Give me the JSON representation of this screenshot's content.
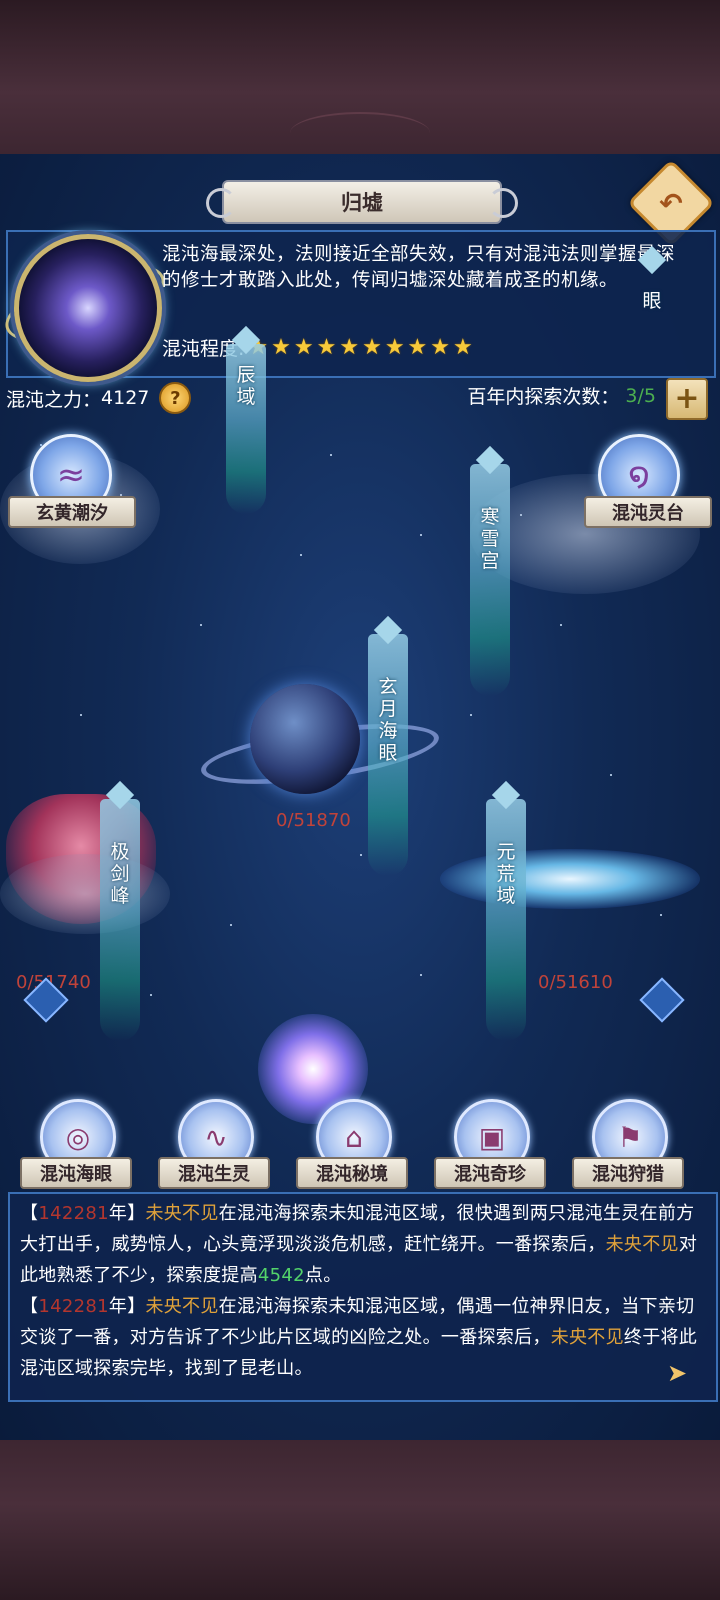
{
  "header": {
    "title": "归墟",
    "back_icon": "back-arrow-icon"
  },
  "info": {
    "description": "混沌海最深处，法则接近全部失效，只有对混沌法则掌握最深的修士才敢踏入此处，传闻归墟深处藏着成圣的机缘。",
    "chaos_level_label": "混沌程度:",
    "chaos_level_stars": 10
  },
  "status": {
    "power_label": "混沌之力：",
    "power_value": "4127",
    "help_icon": "?",
    "explore_label": "百年内探索次数：",
    "explore_count": "3/5",
    "add_icon": "+"
  },
  "map": {
    "locations": [
      {
        "name": "辰域",
        "chars": [
          "辰",
          "域"
        ]
      },
      {
        "name": "眼",
        "chars": [
          "眼"
        ]
      },
      {
        "name": "寒雪宫",
        "chars": [
          "寒",
          "雪",
          "宫"
        ]
      },
      {
        "name": "玄月海眼",
        "chars": [
          "玄",
          "月",
          "海",
          "眼"
        ]
      },
      {
        "name": "极剑峰",
        "chars": [
          "极",
          "剑",
          "峰"
        ]
      },
      {
        "name": "元荒域",
        "chars": [
          "元",
          "荒",
          "域"
        ]
      }
    ],
    "progress": {
      "xuanyue": "0/51870",
      "jijian": "0/51740",
      "yuanhuang": "0/51610"
    },
    "side_nodes": {
      "left": "玄黄潮汐",
      "right": "混沌灵台"
    }
  },
  "bottom_nav": [
    {
      "label": "混沌海眼",
      "icon": "whirlpool-icon"
    },
    {
      "label": "混沌生灵",
      "icon": "creature-icon"
    },
    {
      "label": "混沌秘境",
      "icon": "temple-icon"
    },
    {
      "label": "混沌奇珍",
      "icon": "treasure-chest-icon"
    },
    {
      "label": "混沌狩猎",
      "icon": "hunting-icon"
    }
  ],
  "log": {
    "entries": [
      {
        "year": "142281",
        "actor": "未央不见",
        "text1": "在混沌海探索未知混沌区域，很快遇到两只混沌生灵在前方大打出手，威势惊人，心头竟浮现淡淡危机感，赶忙绕开。一番探索后，",
        "actor2": "未央不见",
        "text2": "对此地熟悉了不少，探索度提高",
        "num": "4542",
        "text3": "点。"
      },
      {
        "year": "142281",
        "actor": "未央不见",
        "text1": "在混沌海探索未知混沌区域，偶遇一位神界旧友，当下亲切交谈了一番，对方告诉了不少此片区域的凶险之处。一番探索后，",
        "actor2": "未央不见",
        "text2": "终于将此混沌区域探索完毕，找到了昆老山。"
      }
    ],
    "bracket_open": "【",
    "bracket_close": "】",
    "year_suffix": "年"
  },
  "colors": {
    "sky": "#112a55",
    "panel_border": "#3a6fb5",
    "year": "#b3362e",
    "actor": "#e0a23a",
    "number": "#53d36a",
    "progress": "#c0433a",
    "star": "#f7c93a"
  }
}
